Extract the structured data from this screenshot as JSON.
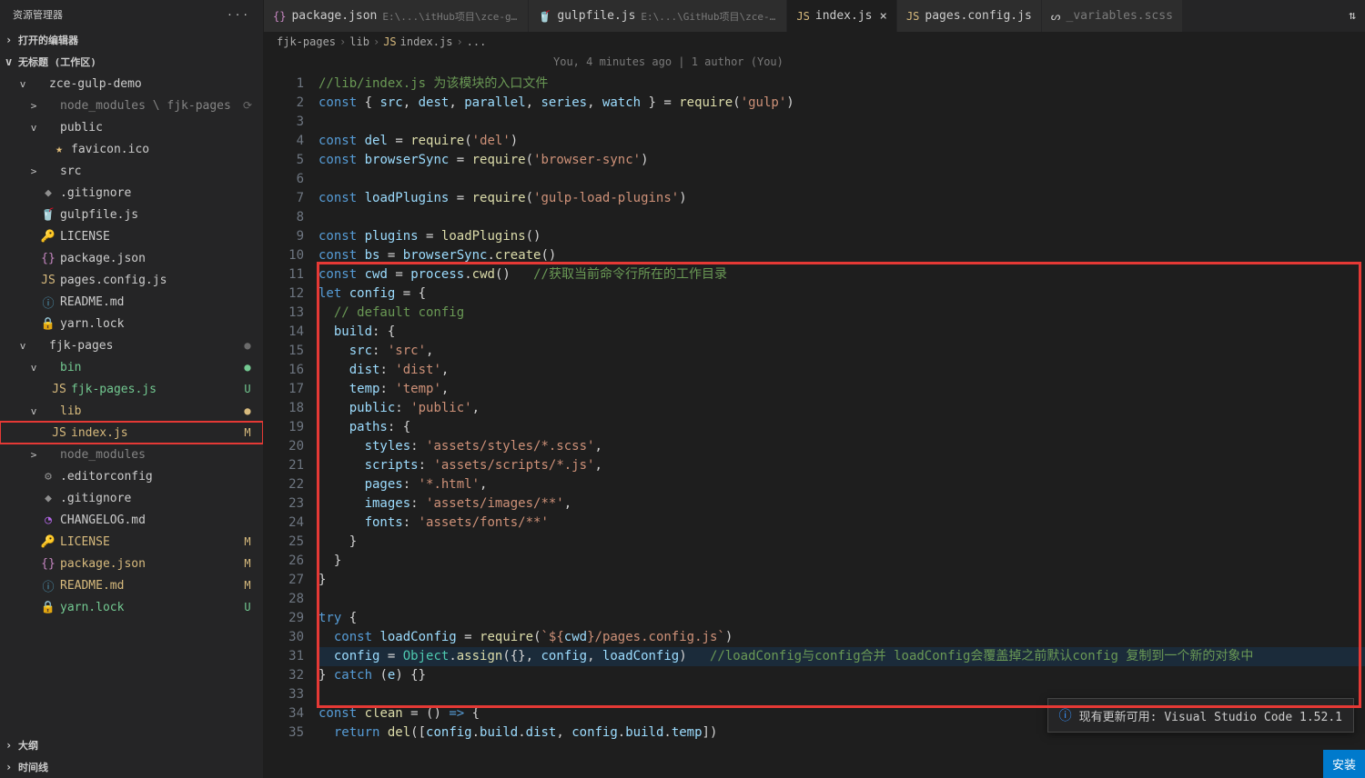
{
  "sidebar": {
    "title": "资源管理器",
    "open_editors": "打开的编辑器",
    "workspace": "无标题 (工作区)",
    "tree": [
      {
        "indent": 1,
        "chev": "v",
        "ico": "",
        "icoc": "ic-fld",
        "lbl": "zce-gulp-demo",
        "cls": ""
      },
      {
        "indent": 2,
        "chev": ">",
        "ico": "",
        "icoc": "ic-fld",
        "lbl": "node_modules \\ fjk-pages",
        "cls": "txt-dim",
        "git": "⟳",
        "gitc": "dot"
      },
      {
        "indent": 2,
        "chev": "v",
        "ico": "",
        "icoc": "ic-fld",
        "lbl": "public",
        "cls": ""
      },
      {
        "indent": 3,
        "chev": "",
        "ico": "★",
        "icoc": "ic-fav",
        "lbl": "favicon.ico",
        "cls": ""
      },
      {
        "indent": 2,
        "chev": ">",
        "ico": "",
        "icoc": "ic-fld",
        "lbl": "src",
        "cls": ""
      },
      {
        "indent": 2,
        "chev": "",
        "ico": "◆",
        "icoc": "ic-cfg",
        "lbl": ".gitignore",
        "cls": ""
      },
      {
        "indent": 2,
        "chev": "",
        "ico": "🥤",
        "icoc": "ic-gulp",
        "lbl": "gulpfile.js",
        "cls": ""
      },
      {
        "indent": 2,
        "chev": "",
        "ico": "🔑",
        "icoc": "ic-lic",
        "lbl": "LICENSE",
        "cls": ""
      },
      {
        "indent": 2,
        "chev": "",
        "ico": "{}",
        "icoc": "ic-json",
        "lbl": "package.json",
        "cls": ""
      },
      {
        "indent": 2,
        "chev": "",
        "ico": "JS",
        "icoc": "ic-js",
        "lbl": "pages.config.js",
        "cls": ""
      },
      {
        "indent": 2,
        "chev": "",
        "ico": "ⓘ",
        "icoc": "ic-md",
        "lbl": "README.md",
        "cls": ""
      },
      {
        "indent": 2,
        "chev": "",
        "ico": "🔒",
        "icoc": "ic-lock",
        "lbl": "yarn.lock",
        "cls": ""
      },
      {
        "indent": 1,
        "chev": "v",
        "ico": "",
        "icoc": "ic-fld",
        "lbl": "fjk-pages",
        "cls": "",
        "git": "●",
        "gitc": "dot"
      },
      {
        "indent": 2,
        "chev": "v",
        "ico": "",
        "icoc": "ic-fld",
        "lbl": "bin",
        "cls": "txt-new",
        "git": "●",
        "gitc": "U"
      },
      {
        "indent": 3,
        "chev": "",
        "ico": "JS",
        "icoc": "ic-js",
        "lbl": "fjk-pages.js",
        "cls": "txt-new",
        "git": "U",
        "gitc": "U"
      },
      {
        "indent": 2,
        "chev": "v",
        "ico": "",
        "icoc": "ic-fld",
        "lbl": "lib",
        "cls": "txt-mod",
        "git": "●",
        "gitc": "M"
      },
      {
        "indent": 3,
        "chev": "",
        "ico": "JS",
        "icoc": "ic-js",
        "lbl": "index.js",
        "cls": "txt-mod",
        "git": "M",
        "gitc": "M",
        "hl": true
      },
      {
        "indent": 2,
        "chev": ">",
        "ico": "",
        "icoc": "ic-fld",
        "lbl": "node_modules",
        "cls": "txt-dim"
      },
      {
        "indent": 2,
        "chev": "",
        "ico": "⚙",
        "icoc": "ic-cfg",
        "lbl": ".editorconfig",
        "cls": ""
      },
      {
        "indent": 2,
        "chev": "",
        "ico": "◆",
        "icoc": "ic-cfg",
        "lbl": ".gitignore",
        "cls": ""
      },
      {
        "indent": 2,
        "chev": "",
        "ico": "◔",
        "icoc": "ic-chg",
        "lbl": "CHANGELOG.md",
        "cls": ""
      },
      {
        "indent": 2,
        "chev": "",
        "ico": "🔑",
        "icoc": "ic-lic",
        "lbl": "LICENSE",
        "cls": "txt-mod",
        "git": "M",
        "gitc": "M"
      },
      {
        "indent": 2,
        "chev": "",
        "ico": "{}",
        "icoc": "ic-json",
        "lbl": "package.json",
        "cls": "txt-mod",
        "git": "M",
        "gitc": "M"
      },
      {
        "indent": 2,
        "chev": "",
        "ico": "ⓘ",
        "icoc": "ic-md",
        "lbl": "README.md",
        "cls": "txt-mod",
        "git": "M",
        "gitc": "M"
      },
      {
        "indent": 2,
        "chev": "",
        "ico": "🔒",
        "icoc": "ic-lock",
        "lbl": "yarn.lock",
        "cls": "txt-new",
        "git": "U",
        "gitc": "U"
      }
    ],
    "outline": "大纲",
    "timeline": "时间线"
  },
  "tabs": [
    {
      "ico": "{}",
      "icoc": "ic-json",
      "lbl": "package.json",
      "path": "E:\\...\\itHub项目\\zce-gulp-demo"
    },
    {
      "ico": "🥤",
      "icoc": "ic-gulp",
      "lbl": "gulpfile.js",
      "path": "E:\\...\\GitHub项目\\zce-gulp-demo"
    },
    {
      "ico": "JS",
      "icoc": "ic-js",
      "lbl": "index.js",
      "active": true,
      "close": true
    },
    {
      "ico": "JS",
      "icoc": "ic-js",
      "lbl": "pages.config.js"
    },
    {
      "ico": "ᔕ",
      "icoc": "",
      "lbl": "_variables.scss",
      "dim": true
    }
  ],
  "sync_icon": "⇅",
  "crumbs": [
    "fjk-pages",
    "lib",
    "index.js",
    "..."
  ],
  "crumb_icon_js": "JS",
  "codelens": "You, 4 minutes ago | 1 author (You)",
  "lines": [
    [
      [
        "c",
        "//lib/index.js 为该模块的入口文件"
      ]
    ],
    [
      [
        "k",
        "const"
      ],
      [
        "p",
        " { "
      ],
      [
        "v",
        "src"
      ],
      [
        "p",
        ", "
      ],
      [
        "v",
        "dest"
      ],
      [
        "p",
        ", "
      ],
      [
        "v",
        "parallel"
      ],
      [
        "p",
        ", "
      ],
      [
        "v",
        "series"
      ],
      [
        "p",
        ", "
      ],
      [
        "v",
        "watch"
      ],
      [
        "p",
        " } = "
      ],
      [
        "f",
        "require"
      ],
      [
        "p",
        "("
      ],
      [
        "s",
        "'gulp'"
      ],
      [
        "p",
        ")"
      ]
    ],
    [],
    [
      [
        "k",
        "const"
      ],
      [
        "p",
        " "
      ],
      [
        "v",
        "del"
      ],
      [
        "p",
        " = "
      ],
      [
        "f",
        "require"
      ],
      [
        "p",
        "("
      ],
      [
        "s",
        "'del'"
      ],
      [
        "p",
        ")"
      ]
    ],
    [
      [
        "k",
        "const"
      ],
      [
        "p",
        " "
      ],
      [
        "v",
        "browserSync"
      ],
      [
        "p",
        " = "
      ],
      [
        "f",
        "require"
      ],
      [
        "p",
        "("
      ],
      [
        "s",
        "'browser-sync'"
      ],
      [
        "p",
        ")"
      ]
    ],
    [],
    [
      [
        "k",
        "const"
      ],
      [
        "p",
        " "
      ],
      [
        "v",
        "loadPlugins"
      ],
      [
        "p",
        " = "
      ],
      [
        "f",
        "require"
      ],
      [
        "p",
        "("
      ],
      [
        "s",
        "'gulp-load-plugins'"
      ],
      [
        "p",
        ")"
      ]
    ],
    [],
    [
      [
        "k",
        "const"
      ],
      [
        "p",
        " "
      ],
      [
        "v",
        "plugins"
      ],
      [
        "p",
        " = "
      ],
      [
        "f",
        "loadPlugins"
      ],
      [
        "p",
        "()"
      ]
    ],
    [
      [
        "k",
        "const"
      ],
      [
        "p",
        " "
      ],
      [
        "v",
        "bs"
      ],
      [
        "p",
        " = "
      ],
      [
        "v",
        "browserSync"
      ],
      [
        "p",
        "."
      ],
      [
        "f",
        "create"
      ],
      [
        "p",
        "()"
      ]
    ],
    [
      [
        "k",
        "const"
      ],
      [
        "p",
        " "
      ],
      [
        "v",
        "cwd"
      ],
      [
        "p",
        " = "
      ],
      [
        "v",
        "process"
      ],
      [
        "p",
        "."
      ],
      [
        "f",
        "cwd"
      ],
      [
        "p",
        "()   "
      ],
      [
        "c",
        "//获取当前命令行所在的工作目录"
      ]
    ],
    [
      [
        "k",
        "let"
      ],
      [
        "p",
        " "
      ],
      [
        "v",
        "config"
      ],
      [
        "p",
        " = {"
      ]
    ],
    [
      [
        "p",
        "  "
      ],
      [
        "c",
        "// default config"
      ]
    ],
    [
      [
        "p",
        "  "
      ],
      [
        "v",
        "build"
      ],
      [
        "p",
        ": {"
      ]
    ],
    [
      [
        "p",
        "    "
      ],
      [
        "v",
        "src"
      ],
      [
        "p",
        ": "
      ],
      [
        "s",
        "'src'"
      ],
      [
        "p",
        ","
      ]
    ],
    [
      [
        "p",
        "    "
      ],
      [
        "v",
        "dist"
      ],
      [
        "p",
        ": "
      ],
      [
        "s",
        "'dist'"
      ],
      [
        "p",
        ","
      ]
    ],
    [
      [
        "p",
        "    "
      ],
      [
        "v",
        "temp"
      ],
      [
        "p",
        ": "
      ],
      [
        "s",
        "'temp'"
      ],
      [
        "p",
        ","
      ]
    ],
    [
      [
        "p",
        "    "
      ],
      [
        "v",
        "public"
      ],
      [
        "p",
        ": "
      ],
      [
        "s",
        "'public'"
      ],
      [
        "p",
        ","
      ]
    ],
    [
      [
        "p",
        "    "
      ],
      [
        "v",
        "paths"
      ],
      [
        "p",
        ": {"
      ]
    ],
    [
      [
        "p",
        "      "
      ],
      [
        "v",
        "styles"
      ],
      [
        "p",
        ": "
      ],
      [
        "s",
        "'assets/styles/*.scss'"
      ],
      [
        "p",
        ","
      ]
    ],
    [
      [
        "p",
        "      "
      ],
      [
        "v",
        "scripts"
      ],
      [
        "p",
        ": "
      ],
      [
        "s",
        "'assets/scripts/*.js'"
      ],
      [
        "p",
        ","
      ]
    ],
    [
      [
        "p",
        "      "
      ],
      [
        "v",
        "pages"
      ],
      [
        "p",
        ": "
      ],
      [
        "s",
        "'*.html'"
      ],
      [
        "p",
        ","
      ]
    ],
    [
      [
        "p",
        "      "
      ],
      [
        "v",
        "images"
      ],
      [
        "p",
        ": "
      ],
      [
        "s",
        "'assets/images/**'"
      ],
      [
        "p",
        ","
      ]
    ],
    [
      [
        "p",
        "      "
      ],
      [
        "v",
        "fonts"
      ],
      [
        "p",
        ": "
      ],
      [
        "s",
        "'assets/fonts/**'"
      ]
    ],
    [
      [
        "p",
        "    }"
      ]
    ],
    [
      [
        "p",
        "  }"
      ]
    ],
    [
      [
        "p",
        "}"
      ]
    ],
    [],
    [
      [
        "k",
        "try"
      ],
      [
        "p",
        " {"
      ]
    ],
    [
      [
        "p",
        "  "
      ],
      [
        "k",
        "const"
      ],
      [
        "p",
        " "
      ],
      [
        "v",
        "loadConfig"
      ],
      [
        "p",
        " = "
      ],
      [
        "f",
        "require"
      ],
      [
        "p",
        "("
      ],
      [
        "s",
        "`${"
      ],
      [
        "v",
        "cwd"
      ],
      [
        "s",
        "}/pages.config.js`"
      ],
      [
        "p",
        ")"
      ]
    ],
    [
      [
        "p",
        "  "
      ],
      [
        "v",
        "config"
      ],
      [
        "p",
        " = "
      ],
      [
        "o",
        "Object"
      ],
      [
        "p",
        "."
      ],
      [
        "f",
        "assign"
      ],
      [
        "p",
        "({}, "
      ],
      [
        "v",
        "config"
      ],
      [
        "p",
        ", "
      ],
      [
        "v",
        "loadConfig"
      ],
      [
        "p",
        ")   "
      ],
      [
        "c",
        "//loadConfig与config合并 loadConfig会覆盖掉之前默认config 复制到一个新的对象中"
      ]
    ],
    [
      [
        "p",
        "} "
      ],
      [
        "k",
        "catch"
      ],
      [
        "p",
        " ("
      ],
      [
        "v",
        "e"
      ],
      [
        "p",
        ") {}"
      ]
    ],
    [],
    [
      [
        "k",
        "const"
      ],
      [
        "p",
        " "
      ],
      [
        "f",
        "clean"
      ],
      [
        "p",
        " = () "
      ],
      [
        "k",
        "=>"
      ],
      [
        "p",
        " {"
      ]
    ],
    [
      [
        "p",
        "  "
      ],
      [
        "k",
        "return"
      ],
      [
        "p",
        " "
      ],
      [
        "f",
        "del"
      ],
      [
        "p",
        "(["
      ],
      [
        "v",
        "config"
      ],
      [
        "p",
        "."
      ],
      [
        "v",
        "build"
      ],
      [
        "p",
        "."
      ],
      [
        "v",
        "dist"
      ],
      [
        "p",
        ", "
      ],
      [
        "v",
        "config"
      ],
      [
        "p",
        "."
      ],
      [
        "v",
        "build"
      ],
      [
        "p",
        "."
      ],
      [
        "v",
        "temp"
      ],
      [
        "p",
        "])"
      ]
    ]
  ],
  "notif": "现有更新可用: Visual Studio Code 1.52.1",
  "install": "安装"
}
